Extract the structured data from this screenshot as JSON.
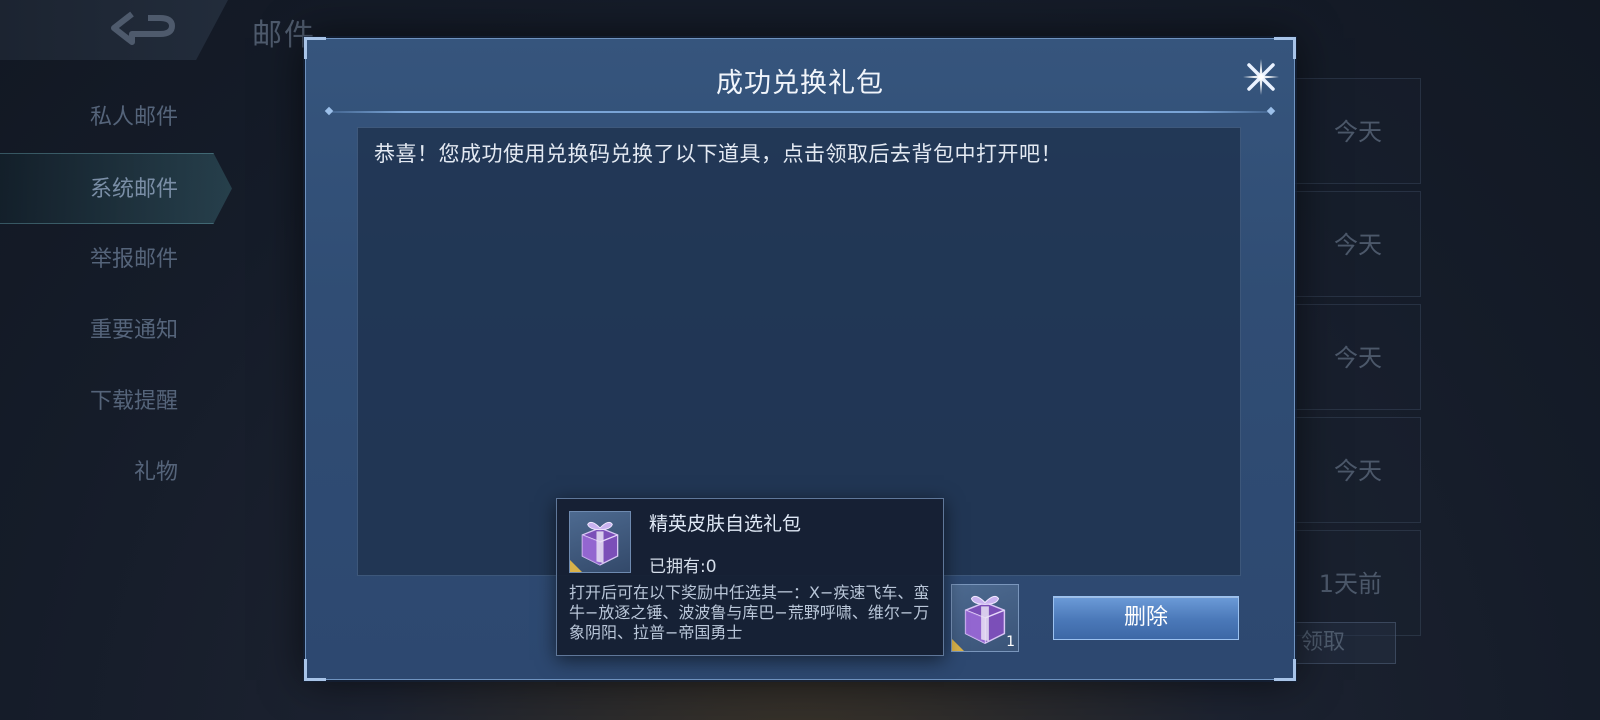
{
  "header": {
    "title": "邮件"
  },
  "sidebar": {
    "items": [
      {
        "label": "私人邮件"
      },
      {
        "label": "系统邮件"
      },
      {
        "label": "举报邮件"
      },
      {
        "label": "重要通知"
      },
      {
        "label": "下载提醒"
      },
      {
        "label": "礼物"
      }
    ],
    "active_index": 1
  },
  "mail_list": {
    "dates": [
      "今天",
      "今天",
      "今天",
      "今天",
      "1天前"
    ],
    "claim_label": "领取"
  },
  "dialog": {
    "title": "成功兑换礼包",
    "message": "恭喜！您成功使用兑换码兑换了以下道具，点击领取后去背包中打开吧！",
    "item": {
      "icon": "purple-gift-box-icon",
      "quantity": "1"
    },
    "delete_label": "删除"
  },
  "tooltip": {
    "name": "精英皮肤自选礼包",
    "owned": "已拥有:0",
    "description": "打开后可在以下奖励中任选其一：X−疾速飞车、蛮牛−放逐之锤、波波鲁与库巴−荒野呼啸、维尔−万象阴阳、拉普−帝国勇士"
  },
  "colors": {
    "dialog_bg": "#304d74",
    "button": "#4a78b8",
    "tooltip_bg": "#162034",
    "gift_purple": "#8a5cc8"
  }
}
